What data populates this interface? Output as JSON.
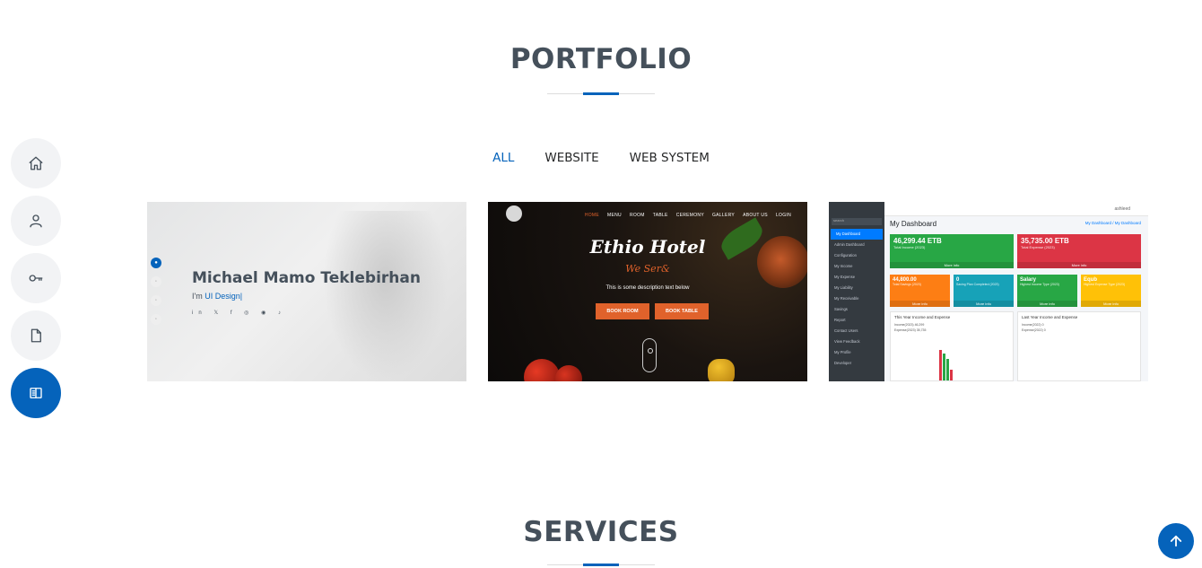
{
  "nav": {
    "items": [
      {
        "name": "home",
        "icon": "home-icon"
      },
      {
        "name": "about",
        "icon": "person-icon"
      },
      {
        "name": "resume",
        "icon": "key-icon"
      },
      {
        "name": "documents",
        "icon": "file-icon"
      },
      {
        "name": "portfolio",
        "icon": "book-open-icon",
        "active": true
      }
    ]
  },
  "portfolio": {
    "title": "PORTFOLIO",
    "filters": [
      {
        "label": "ALL",
        "active": true
      },
      {
        "label": "WEBSITE"
      },
      {
        "label": "WEB SYSTEM"
      }
    ],
    "card1": {
      "name": "Michael Mamo Teklebirhan",
      "sub_prefix": "I'm ",
      "sub_role": "UI Design|",
      "social": "in  𝕏  f  ◎  ◉  ♪"
    },
    "card2": {
      "menu": [
        "HOME",
        "MENU",
        "ROOM",
        "TABLE",
        "CEREMONY",
        "GALLERY",
        "ABOUT US",
        "LOGIN"
      ],
      "title": "Ethio Hotel",
      "subtitle": "We Ser&",
      "description": "This is some description text below",
      "btn_room": "BOOK ROOM",
      "btn_table": "BOOK TABLE"
    },
    "card3": {
      "search": "search",
      "user": "ashleed",
      "sidebar": [
        "My Dashboard",
        "Admin Dashboard",
        "Configuration",
        "My Income",
        "My Expense",
        "My Liability",
        "My Receivable",
        "Savings",
        "Report",
        "Contact Users",
        "View Feedback",
        "My Profile",
        "Developer"
      ],
      "title": "My Dashboard",
      "breadcrumb": "My Dashboard / My Dashboard",
      "box1_value": "46,299.44 ETB",
      "box1_label": "Total Income (2023)",
      "box2_value": "35,735.00 ETB",
      "box2_label": "Total Expense (2023)",
      "more_info": "More info",
      "s1_value": "44,800.00",
      "s1_label": "Total Savings (2023)",
      "s2_value": "0",
      "s2_label": "Saving Plan Completed (2023)",
      "s3_value": "Salary",
      "s3_label": "Highest Income Type (2023)",
      "s4_value": "Equb",
      "s4_label": "Highest Expense Type (2023)",
      "panel1_title": "This Year Income and Expense",
      "panel1_line1": "Income(2023) 46,299",
      "panel1_line2": "Expense(2023) 35,735",
      "panel2_title": "Last Year Income and Expense",
      "panel2_line1": "Income(2022) 0",
      "panel2_line2": "Expense(2022) 0",
      "panel_more": "More"
    }
  },
  "services": {
    "title": "SERVICES"
  },
  "colors": {
    "accent": "#0563bb",
    "text": "#45505b",
    "green": "#28a745",
    "red": "#dc3545",
    "orange": "#fd7e14",
    "teal": "#17a2b8",
    "yellow": "#ffc107"
  }
}
